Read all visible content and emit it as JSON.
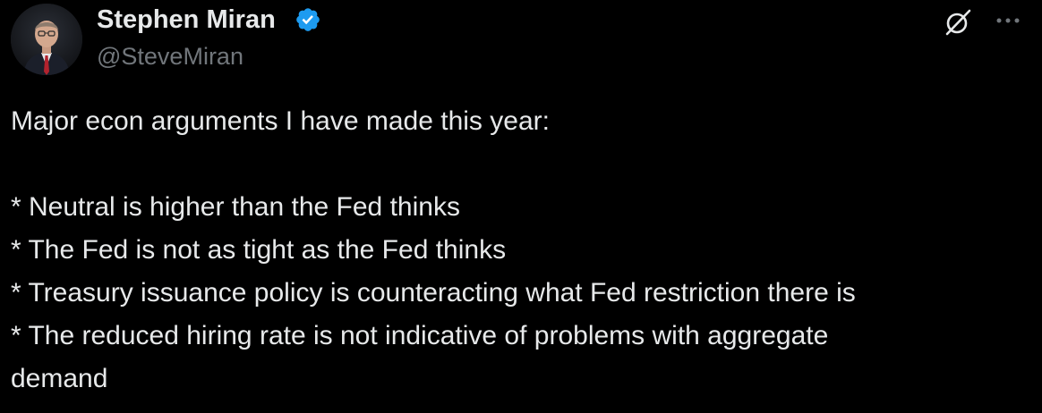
{
  "user": {
    "display_name": "Stephen Miran",
    "handle": "@SteveMiran",
    "verified": true,
    "verified_color": "#1d9bf0",
    "avatar_icon": "profile-photo"
  },
  "header_actions": {
    "grok_icon": "grok-icon",
    "more_icon": "more-dots-icon"
  },
  "tweet": {
    "intro": "Major econ arguments I have made this year:",
    "bullets": [
      "* Neutral is higher than the Fed thinks",
      "* The Fed is not as tight as the Fed thinks",
      "* Treasury issuance policy is counteracting what Fed restriction there is",
      "* The reduced hiring rate is not indicative of problems with aggregate"
    ],
    "continuation": "demand"
  },
  "colors": {
    "background": "#000000",
    "text": "#e7e9ea",
    "secondary": "#71767b"
  }
}
